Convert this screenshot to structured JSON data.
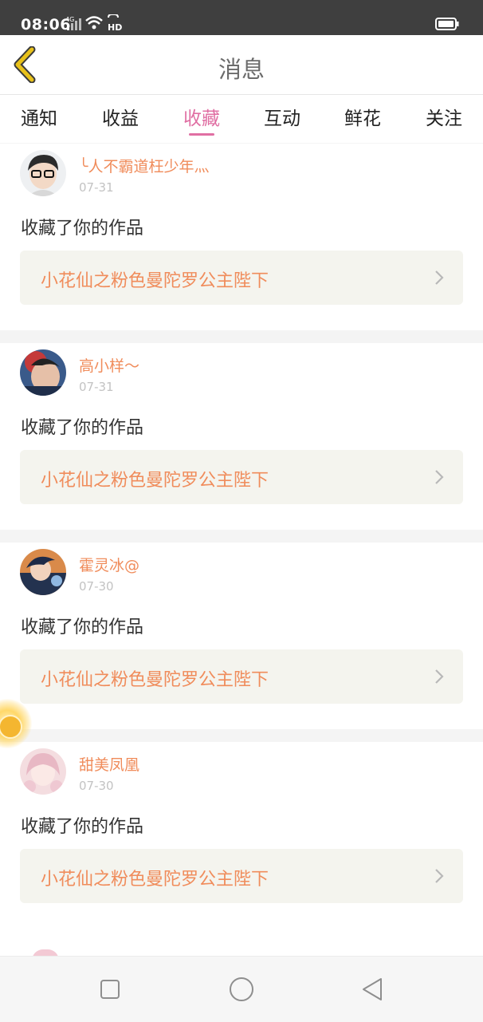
{
  "status_bar": {
    "time": "08:06",
    "network": "4G",
    "extra": "HD"
  },
  "header": {
    "title": "消息"
  },
  "tabs": [
    {
      "label": "通知"
    },
    {
      "label": "收益"
    },
    {
      "label": "收藏",
      "active": true
    },
    {
      "label": "互动"
    },
    {
      "label": "鲜花"
    },
    {
      "label": "关注"
    }
  ],
  "messages": [
    {
      "username": "╰人不霸道枉少年灬",
      "date": "07-31",
      "action": "收藏了你的作品",
      "work_title": "小花仙之粉色曼陀罗公主陛下"
    },
    {
      "username": "高小样～",
      "date": "07-31",
      "action": "收藏了你的作品",
      "work_title": "小花仙之粉色曼陀罗公主陛下"
    },
    {
      "username": "霍灵冰@",
      "date": "07-30",
      "action": "收藏了你的作品",
      "work_title": "小花仙之粉色曼陀罗公主陛下"
    },
    {
      "username": "甜美凤凰",
      "date": "07-30",
      "action": "收藏了你的作品",
      "work_title": "小花仙之粉色曼陀罗公主陛下"
    }
  ],
  "colors": {
    "accent": "#e06fa3",
    "name": "#f08c5b",
    "back_arrow": "#e8c11a"
  },
  "icons": {
    "back": "chevron-left-icon",
    "nav_square": "square-icon",
    "nav_home": "circle-icon",
    "nav_back": "triangle-back-icon"
  }
}
